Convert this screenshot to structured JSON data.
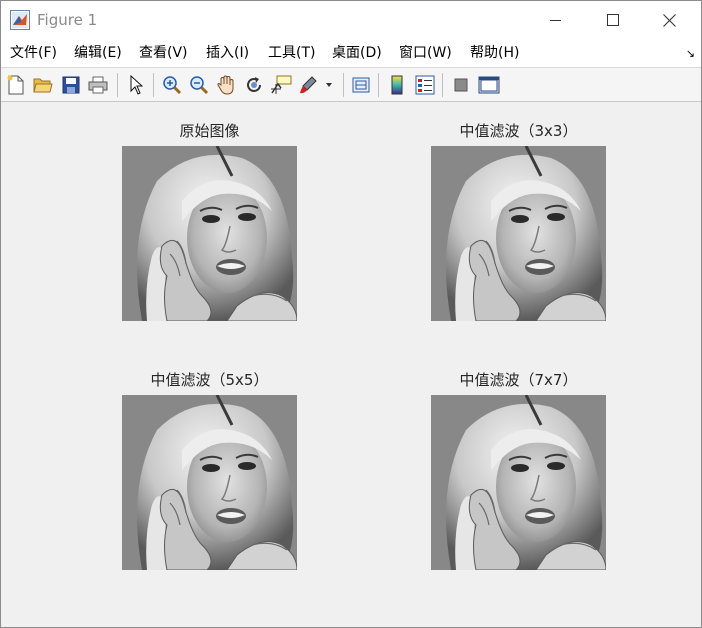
{
  "window": {
    "title": "Figure 1",
    "icons": {
      "app": "matlab-figure-icon",
      "minimize": "minimize-icon",
      "maximize": "maximize-icon",
      "close": "close-icon"
    }
  },
  "menubar": {
    "items": [
      {
        "label": "文件(F)"
      },
      {
        "label": "编辑(E)"
      },
      {
        "label": "查看(V)"
      },
      {
        "label": "插入(I)"
      },
      {
        "label": "工具(T)"
      },
      {
        "label": "桌面(D)"
      },
      {
        "label": "窗口(W)"
      },
      {
        "label": "帮助(H)"
      }
    ],
    "corner_icon": "dock-arrow-icon"
  },
  "toolbar": {
    "buttons": [
      "new-figure-icon",
      "open-file-icon",
      "save-icon",
      "print-icon",
      "pointer-icon",
      "zoom-in-icon",
      "zoom-out-icon",
      "pan-hand-icon",
      "rotate-3d-icon",
      "data-cursor-icon",
      "brush-icon",
      "link-plot-icon",
      "colorbar-icon",
      "legend-icon",
      "hide-plot-tools-icon",
      "show-plot-tools-icon"
    ]
  },
  "figure": {
    "subplots": [
      {
        "title": "原始图像"
      },
      {
        "title": "中值滤波（3x3）"
      },
      {
        "title": "中值滤波（5x5）"
      },
      {
        "title": "中值滤波（7x7）"
      }
    ],
    "colors": {
      "background": "#f0f0f0",
      "title_text": "#262626"
    }
  }
}
